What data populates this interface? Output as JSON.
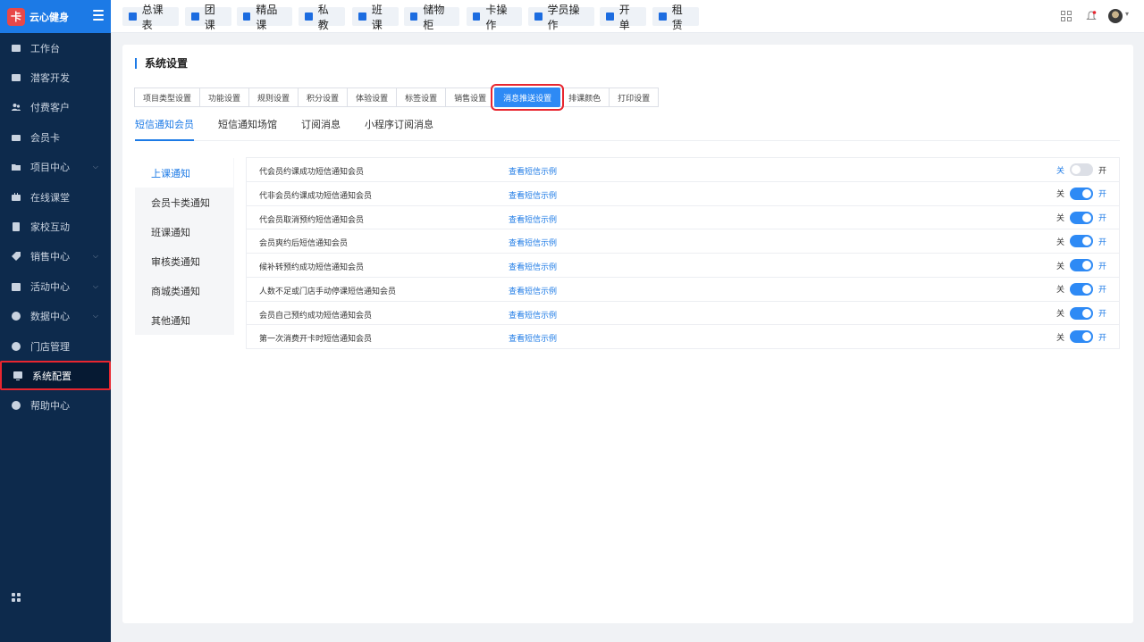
{
  "brand": {
    "name": "云心健身",
    "logo_char": "卡"
  },
  "sidebar": {
    "items": [
      {
        "label": "工作台",
        "icon": "image-icon",
        "chevron": false
      },
      {
        "label": "潜客开发",
        "icon": "id-card-icon",
        "chevron": false
      },
      {
        "label": "付费客户",
        "icon": "users-icon",
        "chevron": false
      },
      {
        "label": "会员卡",
        "icon": "card-icon",
        "chevron": false
      },
      {
        "label": "项目中心",
        "icon": "folder-icon",
        "chevron": true
      },
      {
        "label": "在线课堂",
        "icon": "video-icon",
        "chevron": false
      },
      {
        "label": "家校互动",
        "icon": "contact-icon",
        "chevron": false
      },
      {
        "label": "销售中心",
        "icon": "tag-icon",
        "chevron": true
      },
      {
        "label": "活动中心",
        "icon": "calendar-icon",
        "chevron": true
      },
      {
        "label": "数据中心",
        "icon": "pie-chart-icon",
        "chevron": true
      },
      {
        "label": "门店管理",
        "icon": "store-icon",
        "chevron": false
      },
      {
        "label": "系统配置",
        "icon": "monitor-icon",
        "chevron": false,
        "active": true
      },
      {
        "label": "帮助中心",
        "icon": "help-icon",
        "chevron": false
      }
    ]
  },
  "topbar": {
    "buttons": [
      "总课表",
      "团课",
      "精品课",
      "私教",
      "班课",
      "储物柜",
      "卡操作",
      "学员操作",
      "开单",
      "租赁"
    ]
  },
  "page": {
    "title": "系统设置",
    "settings_tabs": [
      "项目类型设置",
      "功能设置",
      "规则设置",
      "积分设置",
      "体验设置",
      "标签设置",
      "销售设置",
      "消息推送设置",
      "排课颜色",
      "打印设置"
    ],
    "active_settings_tab": 7,
    "subtabs": [
      "短信通知会员",
      "短信通知场馆",
      "订阅消息",
      "小程序订阅消息"
    ],
    "active_subtab": 0,
    "left_menu": [
      "上课通知",
      "会员卡类通知",
      "班课通知",
      "审核类通知",
      "商城类通知",
      "其他通知"
    ],
    "active_left_menu": 0,
    "link_label": "查看短信示例",
    "off_label": "关",
    "on_label": "开",
    "rows": [
      {
        "name": "代会员约课成功短信通知会员",
        "on": false
      },
      {
        "name": "代非会员约课成功短信通知会员",
        "on": true
      },
      {
        "name": "代会员取消预约短信通知会员",
        "on": true
      },
      {
        "name": "会员爽约后短信通知会员",
        "on": true
      },
      {
        "name": "候补转预约成功短信通知会员",
        "on": true
      },
      {
        "name": "人数不足或门店手动停课短信通知会员",
        "on": true
      },
      {
        "name": "会员自己预约成功短信通知会员",
        "on": true
      },
      {
        "name": "第一次消费开卡时短信通知会员",
        "on": true
      }
    ]
  },
  "colors": {
    "sidebar_bg": "#0d2a4c",
    "brand_bg": "#1c7ae6",
    "accent": "#2e8af5",
    "highlight": "#e8262f"
  }
}
